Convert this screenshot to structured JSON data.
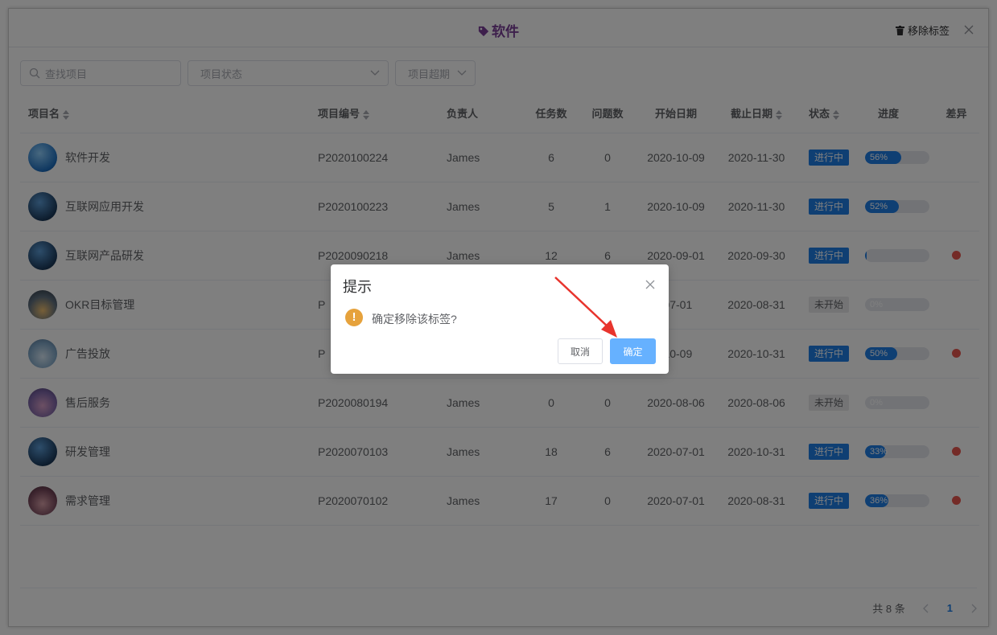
{
  "header": {
    "title": "软件",
    "remove_tag_label": "移除标签",
    "title_color": "#7b3f98"
  },
  "filters": {
    "search_placeholder": "查找项目",
    "status_placeholder": "项目状态",
    "overdue_placeholder": "项目超期"
  },
  "table": {
    "columns": [
      "项目名",
      "项目编号",
      "负责人",
      "任务数",
      "问题数",
      "开始日期",
      "截止日期",
      "状态",
      "进度",
      "差异"
    ],
    "rows": [
      {
        "name": "软件开发",
        "code": "P2020100224",
        "owner": "James",
        "tasks": "6",
        "issues": "0",
        "start": "2020-10-09",
        "end": "2020-11-30",
        "status": "进行中",
        "progress": 56,
        "progress_text": "56%",
        "diff": false
      },
      {
        "name": "互联网应用开发",
        "code": "P2020100223",
        "owner": "James",
        "tasks": "5",
        "issues": "1",
        "start": "2020-10-09",
        "end": "2020-11-30",
        "status": "进行中",
        "progress": 52,
        "progress_text": "52%",
        "diff": false
      },
      {
        "name": "互联网产品研发",
        "code": "P2020090218",
        "owner": "James",
        "tasks": "12",
        "issues": "6",
        "start": "2020-09-01",
        "end": "2020-09-30",
        "status": "进行中",
        "progress": 3,
        "progress_text": "",
        "diff": true
      },
      {
        "name": "OKR目标管理",
        "code": "P",
        "owner": "",
        "tasks": "",
        "issues": "",
        "start": "-07-01",
        "end": "2020-08-31",
        "status": "未开始",
        "progress": 0,
        "progress_text": "0%",
        "diff": false
      },
      {
        "name": "广告投放",
        "code": "P",
        "owner": "",
        "tasks": "",
        "issues": "",
        "start": "-10-09",
        "end": "2020-10-31",
        "status": "进行中",
        "progress": 50,
        "progress_text": "50%",
        "diff": true
      },
      {
        "name": "售后服务",
        "code": "P2020080194",
        "owner": "James",
        "tasks": "0",
        "issues": "0",
        "start": "2020-08-06",
        "end": "2020-08-06",
        "status": "未开始",
        "progress": 0,
        "progress_text": "0%",
        "diff": false
      },
      {
        "name": "研发管理",
        "code": "P2020070103",
        "owner": "James",
        "tasks": "18",
        "issues": "6",
        "start": "2020-07-01",
        "end": "2020-10-31",
        "status": "进行中",
        "progress": 33,
        "progress_text": "33%",
        "diff": true
      },
      {
        "name": "需求管理",
        "code": "P2020070102",
        "owner": "James",
        "tasks": "17",
        "issues": "0",
        "start": "2020-07-01",
        "end": "2020-08-31",
        "status": "进行中",
        "progress": 36,
        "progress_text": "36%",
        "diff": true
      }
    ]
  },
  "pager": {
    "total": "共 8 条",
    "current": "1"
  },
  "dialog": {
    "title": "提示",
    "message": "确定移除该标签?",
    "cancel_label": "取消",
    "confirm_label": "确定"
  },
  "colors": {
    "accent": "#1e7ee6",
    "warning": "#e6a23c",
    "danger": "#e8574f",
    "confirm": "#66b1ff"
  }
}
